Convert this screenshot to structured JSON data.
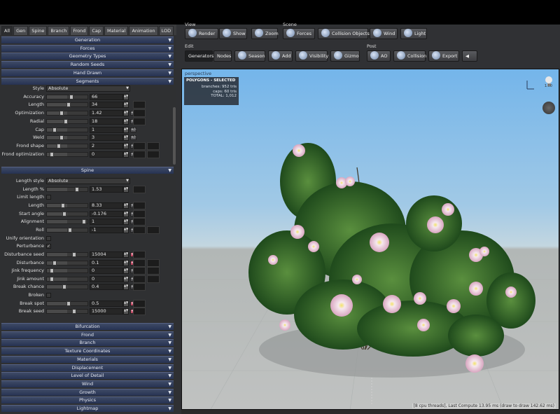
{
  "tabs": [
    "All",
    "Gen",
    "Spine",
    "Branch",
    "Frond",
    "Cap",
    "Material",
    "Animation",
    "LOD"
  ],
  "sections_top": [
    "Generation",
    "Forces",
    "Geometry Types",
    "Random Seeds",
    "Hand Drawn",
    "Segments"
  ],
  "segments_rows": [
    {
      "label": "Style",
      "type": "select",
      "value": "Absolute"
    },
    {
      "label": "Accuracy",
      "type": "slider",
      "value": "66"
    },
    {
      "label": "Length",
      "type": "slider",
      "value": "34"
    },
    {
      "label": "Optimization",
      "type": "slider",
      "value": "1.42"
    },
    {
      "label": "Radial",
      "type": "slider",
      "value": "18"
    },
    {
      "label": "Cap",
      "type": "slider",
      "value": "1"
    },
    {
      "label": "Weld",
      "type": "slider",
      "value": "3"
    },
    {
      "label": "Frond shape",
      "type": "slider",
      "value": "2"
    },
    {
      "label": "Frond optimization",
      "type": "slider",
      "value": "0"
    }
  ],
  "spine_title": "Spine",
  "spine_rows": [
    {
      "label": "Length style",
      "type": "select",
      "value": "Absolute"
    },
    {
      "label": "Length %",
      "type": "slider",
      "value": "1.53"
    },
    {
      "label": "Limit length",
      "type": "check",
      "value": ""
    },
    {
      "label": "Length",
      "type": "slider",
      "value": "8.33"
    },
    {
      "label": "Start angle",
      "type": "slider",
      "value": "-0.176"
    },
    {
      "label": "Alignment",
      "type": "slider",
      "value": "1"
    },
    {
      "label": "Roll",
      "type": "slider",
      "value": "-1"
    },
    {
      "label": "Unify orientation",
      "type": "check",
      "value": ""
    },
    {
      "label": "Perturbance",
      "type": "check",
      "value": "✓"
    },
    {
      "label": "Disturbance seed",
      "type": "slider",
      "value": "15004"
    },
    {
      "label": "Disturbance",
      "type": "slider",
      "value": "0.1"
    },
    {
      "label": "Jink frequency",
      "type": "slider",
      "value": "0"
    },
    {
      "label": "Jink amount",
      "type": "slider",
      "value": "0"
    },
    {
      "label": "Break chance",
      "type": "slider",
      "value": "0.4"
    },
    {
      "label": "Broken",
      "type": "check",
      "value": ""
    },
    {
      "label": "Break spot",
      "type": "slider",
      "value": "0.5"
    },
    {
      "label": "Break seed",
      "type": "slider",
      "value": "15000"
    }
  ],
  "sections_bottom": [
    "Bifurcation",
    "Frond",
    "Branch",
    "Texture Coordinates",
    "Materials",
    "Displacement",
    "Level of Detail",
    "Wind",
    "Growth",
    "Physics",
    "Lightmap"
  ],
  "toolbar": {
    "view_label": "View",
    "scene_label": "Scene",
    "edit_label": "Edit",
    "post_label": "Post",
    "view_buttons": [
      "Render",
      "Show",
      "Zoom"
    ],
    "scene_buttons": [
      "Forces",
      "Collision Objects",
      "Wind",
      "Light"
    ],
    "edit_tabs": [
      "Generators",
      "Nodes"
    ],
    "edit_buttons": [
      "Season",
      "Add",
      "Visibility",
      "Gizmo"
    ],
    "post_buttons": [
      "AO",
      "Collision",
      "Export"
    ]
  },
  "viewport": {
    "label": "perspective",
    "stats_title": "POLYGONS - SELECTED",
    "stats_rows": [
      "branches: 952 tris",
      "caps: 60 tris",
      "TOTAL: 1,012"
    ],
    "status": "[8 cpu threads], Last Compute 13.95 ms (draw to draw 142.62 ms)",
    "light_value": "1.00"
  }
}
